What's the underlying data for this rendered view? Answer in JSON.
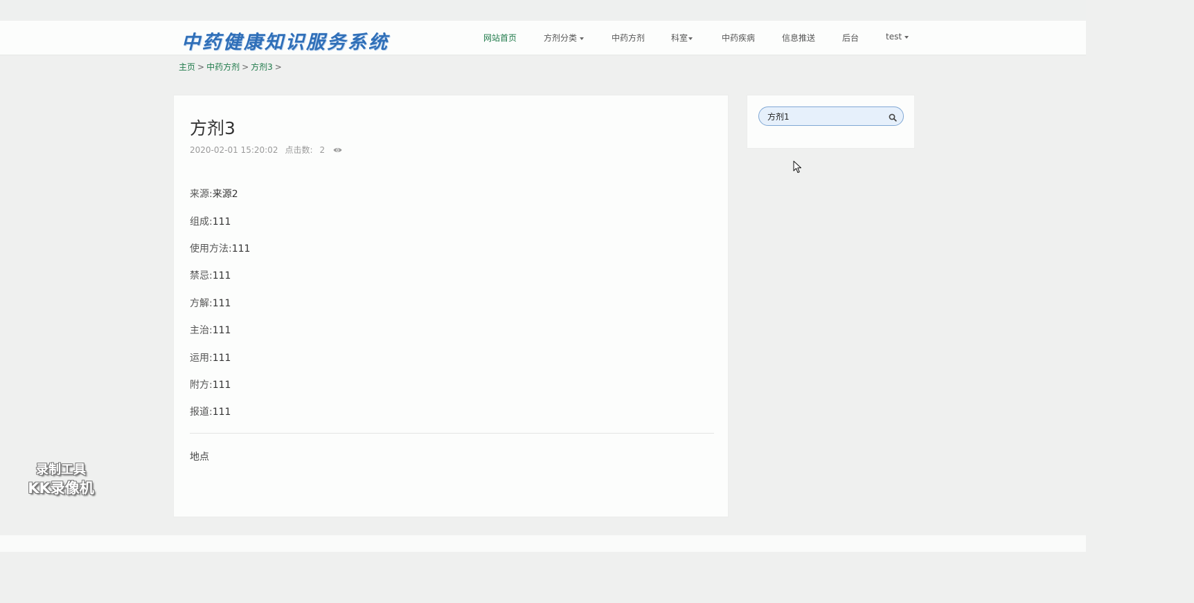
{
  "site": {
    "logo_text": "中药健康知识服务系统"
  },
  "nav": {
    "items": [
      {
        "label": "网站首页"
      },
      {
        "label": "方剂分类"
      },
      {
        "label": "中药方剂"
      },
      {
        "label": "科室"
      },
      {
        "label": "中药疾病"
      },
      {
        "label": "信息推送"
      },
      {
        "label": "后台"
      },
      {
        "label": "test"
      }
    ],
    "active_color": "#1f7a4a"
  },
  "breadcrumb": {
    "items": [
      "主页",
      "中药方剂",
      "方剂3"
    ],
    "separator": ">"
  },
  "article": {
    "title": "方剂3",
    "date": "2020-02-01 15:20:02",
    "views_label": "点击数:",
    "views": "2",
    "fields": [
      {
        "label": "来源:",
        "value": "来源2"
      },
      {
        "label": "组成:",
        "value": "111"
      },
      {
        "label": "使用方法:",
        "value": "111"
      },
      {
        "label": "禁忌:",
        "value": "111"
      },
      {
        "label": "方解:",
        "value": "111"
      },
      {
        "label": "主治:",
        "value": "111"
      },
      {
        "label": "运用:",
        "value": "111"
      },
      {
        "label": "附方:",
        "value": "111"
      },
      {
        "label": "报道:",
        "value": "111"
      }
    ],
    "location_label": "地点"
  },
  "search": {
    "value": "方剂1"
  },
  "watermark": {
    "line1": "录制工具",
    "line2": "KK录像机"
  },
  "colors": {
    "background": "#eff0ef",
    "card": "#fcfdfc",
    "link": "#1f7a4a",
    "logo": "#2f6fb8",
    "search_bg": "#e6f0fb",
    "search_border": "#7fa7d4"
  }
}
